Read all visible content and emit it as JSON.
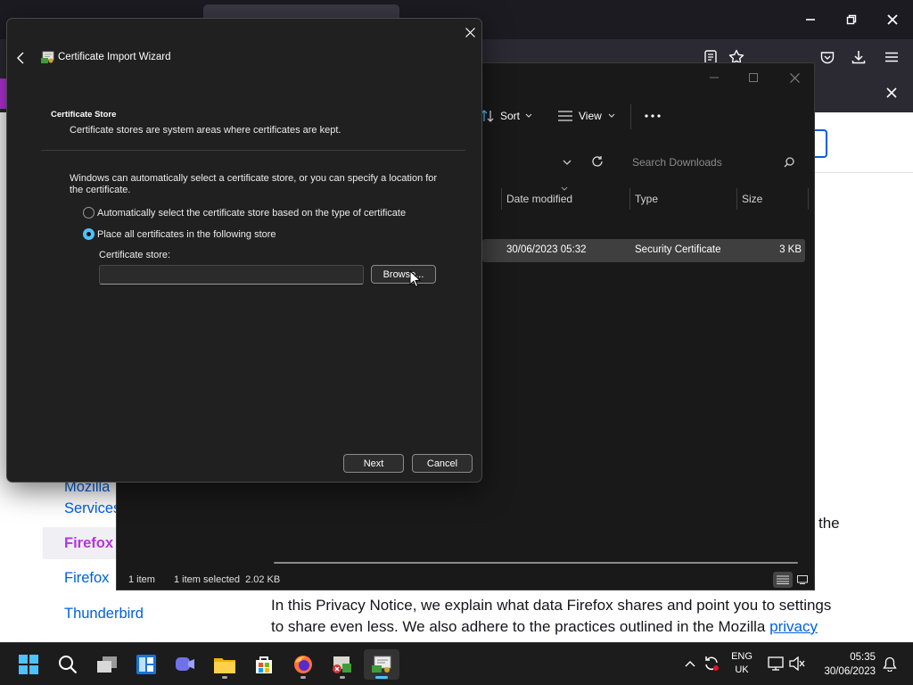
{
  "browser": {
    "tab_title": "",
    "window_controls": [
      "minimize-icon",
      "restore-icon",
      "close-icon"
    ],
    "toolbar_icons": [
      "reader-view-icon",
      "bookmark-star-icon",
      "pocket-icon",
      "downloads-icon",
      "menu-icon"
    ]
  },
  "page": {
    "sidebar_links": [
      "Mozilla",
      "Services",
      "Firefox",
      "Firefox",
      "Thunderbird"
    ],
    "active_link_index": 2,
    "trailing_word": "the",
    "paragraph_line1": "In this Privacy Notice, we explain what data Firefox shares and point you to settings",
    "paragraph_line2_prefix": "to share even less. We also adhere to the practices outlined in the Mozilla ",
    "paragraph_link": "privacy"
  },
  "explorer": {
    "toolbar": {
      "sort_label": "Sort",
      "view_label": "View",
      "more_label": "..."
    },
    "search_placeholder": "Search Downloads",
    "columns": [
      "Date modified",
      "Type",
      "Size"
    ],
    "rows": [
      {
        "date": "30/06/2023 05:32",
        "type": "Security Certificate",
        "size": "3 KB"
      }
    ],
    "status_count": "1 item",
    "status_selection": "1 item selected  2.02 KB"
  },
  "dialog": {
    "title": "Certificate Import Wizard",
    "section_title": "Certificate Store",
    "section_desc": "Certificate stores are system areas where certificates are kept.",
    "intro_line1": "Windows can automatically select a certificate store, or you can specify a location for",
    "intro_line2": "the certificate.",
    "option_auto": "Automatically select the certificate store based on the type of certificate",
    "option_manual": "Place all certificates in the following store",
    "selected_option": "manual",
    "store_label": "Certificate store:",
    "store_value": "",
    "browse_label": "Browse...",
    "next_label": "Next",
    "cancel_label": "Cancel"
  },
  "taskbar": {
    "icons": [
      "start-icon",
      "search-icon",
      "task-view-icon",
      "widgets-icon",
      "chat-icon",
      "file-explorer-icon",
      "store-icon",
      "firefox-icon",
      "app-icon",
      "certificate-wizard-icon"
    ],
    "lang_line1": "ENG",
    "lang_line2": "UK",
    "time": "05:35",
    "date": "30/06/2023"
  },
  "colors": {
    "accent": "#4cc2ff",
    "link": "#0060df",
    "firefox_link": "#b833e1",
    "dialog_bg": "#202020",
    "explorer_bg": "#191919",
    "taskbar_bg": "#1c1c1c"
  }
}
